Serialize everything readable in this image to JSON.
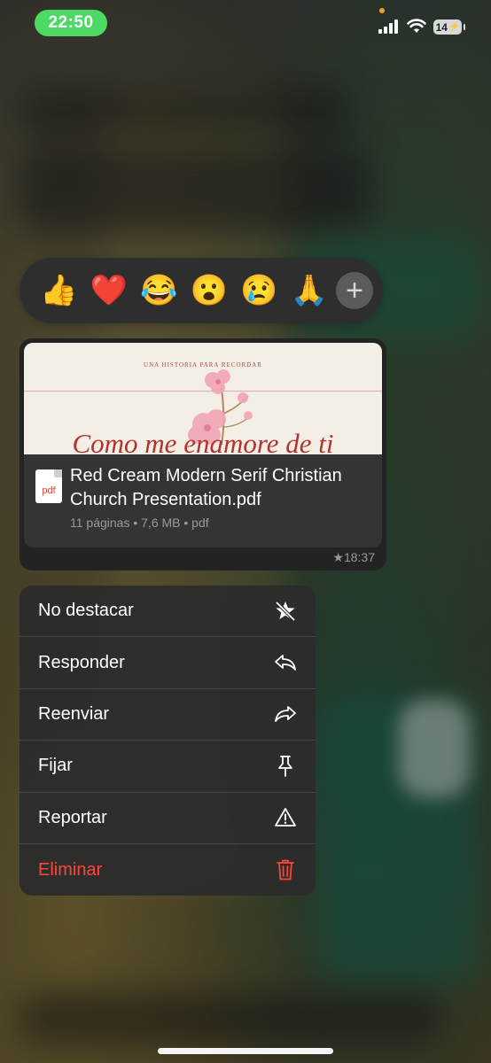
{
  "status_bar": {
    "time": "22:50",
    "battery": "14"
  },
  "reactions": {
    "emojis": [
      "👍",
      "❤️",
      "😂",
      "😮",
      "😢",
      "🙏"
    ],
    "more_label": "+"
  },
  "message": {
    "preview": {
      "subtitle": "UNA HISTORIA PARA RECORDAR",
      "title": "Como me enamore de ti"
    },
    "file": {
      "icon_label": "pdf",
      "name": "Red Cream Modern Serif Christian Church Presentation.pdf",
      "meta": "11 páginas • 7,6 MB • pdf"
    },
    "time": "★18:37"
  },
  "menu": {
    "items": [
      {
        "label": "No destacar",
        "icon": "unstar-icon"
      },
      {
        "label": "Responder",
        "icon": "reply-icon"
      },
      {
        "label": "Reenviar",
        "icon": "forward-icon"
      },
      {
        "label": "Fijar",
        "icon": "pin-icon"
      },
      {
        "label": "Reportar",
        "icon": "warning-icon"
      },
      {
        "label": "Eliminar",
        "icon": "trash-icon"
      }
    ]
  },
  "colors": {
    "time_pill": "#4cd964",
    "danger": "#ff453a",
    "pdf": "#e0433a"
  }
}
